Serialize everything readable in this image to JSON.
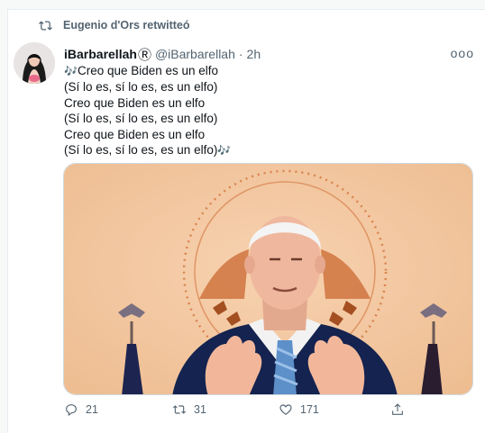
{
  "retweet": {
    "label": "Eugenio d'Ors retwitteó",
    "icon": "retweet-icon"
  },
  "tweet": {
    "display_name": "iBarbarellah",
    "badge": "Ⓡ",
    "handle": "@iBarbarellah",
    "separator": "·",
    "time": "2h",
    "more_label": "ooo",
    "note_emoji": "🎶",
    "lines": [
      "Creo que Biden es un elfo",
      "(Sí lo es, sí lo es, es un elfo)",
      "Creo que Biden es un elfo",
      "(Sí lo es, sí lo es, es un elfo)",
      "Creo que Biden es un elfo",
      "(Sí lo es, sí lo es, es un elfo)"
    ]
  },
  "actions": {
    "reply_count": "21",
    "retweet_count": "31",
    "like_count": "171",
    "reply_icon": "reply-icon",
    "retweet_icon": "retweet-icon",
    "like_icon": "heart-icon",
    "share_icon": "share-icon"
  },
  "colors": {
    "accent": "#1d9bf0",
    "muted": "#536471",
    "text": "#0f1419"
  }
}
